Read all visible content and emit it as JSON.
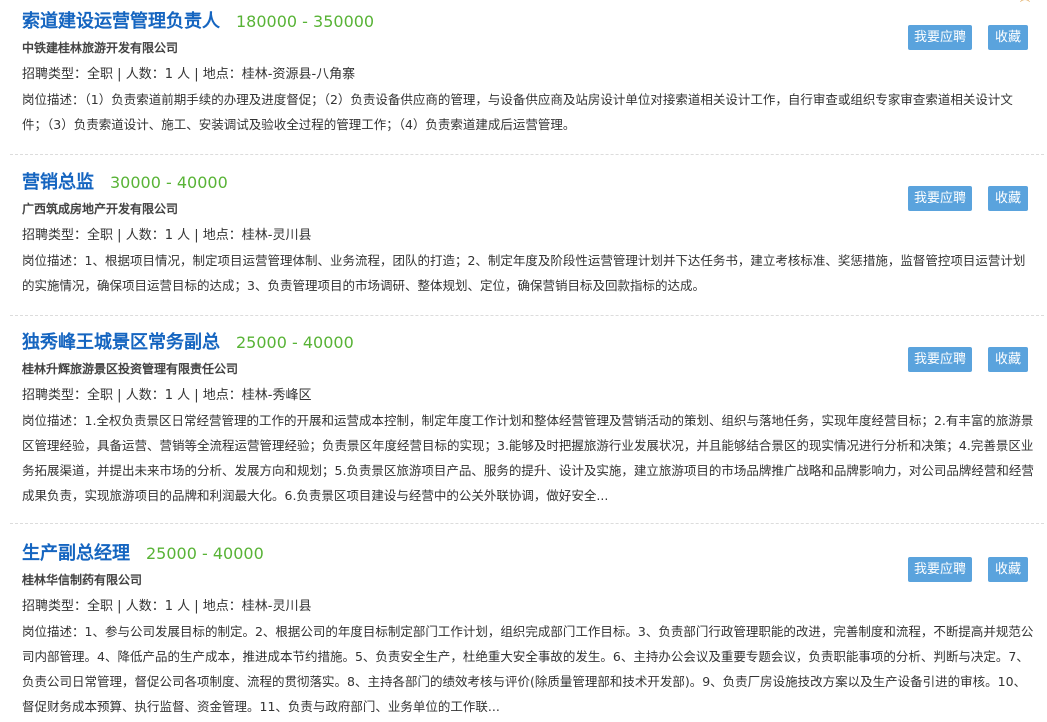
{
  "labels": {
    "type_prefix": "招聘类型：",
    "count_prefix": "人数：",
    "location_prefix": "地点：",
    "desc_prefix": "岗位描述：",
    "apply": "我要应聘",
    "save": "收藏"
  },
  "jobs": [
    {
      "title": "索道建设运营管理负责人",
      "salary": "180000 - 350000",
      "company": "中铁建桂林旅游开发有限公司",
      "type": "全职",
      "count": "1 人",
      "location": "桂林-资源县-八角寨",
      "description": "（1）负责索道前期手续的办理及进度督促；（2）负责设备供应商的管理，与设备供应商及站房设计单位对接索道相关设计工作，自行审查或组织专家审查索道相关设计文件；（3）负责索道设计、施工、安装调试及验收全过程的管理工作；（4）负责索道建成后运营管理。"
    },
    {
      "title": "营销总监",
      "salary": "30000 - 40000",
      "company": "广西筑成房地产开发有限公司",
      "type": "全职",
      "count": "1 人",
      "location": "桂林-灵川县",
      "description": "1、根据项目情况，制定项目运营管理体制、业务流程，团队的打造；2、制定年度及阶段性运营管理计划并下达任务书，建立考核标准、奖惩措施，监督管控项目运营计划的实施情况，确保项目运营目标的达成；3、负责管理项目的市场调研、整体规划、定位，确保营销目标及回款指标的达成。"
    },
    {
      "title": "独秀峰王城景区常务副总",
      "salary": "25000 - 40000",
      "company": "桂林升辉旅游景区投资管理有限责任公司",
      "type": "全职",
      "count": "1 人",
      "location": "桂林-秀峰区",
      "description": "1.全权负责景区日常经营管理的工作的开展和运营成本控制，制定年度工作计划和整体经营管理及营销活动的策划、组织与落地任务，实现年度经营目标；2.有丰富的旅游景区管理经验，具备运营、营销等全流程运营管理经验；负责景区年度经营目标的实现；3.能够及时把握旅游行业发展状况，并且能够结合景区的现实情况进行分析和决策；4.完善景区业务拓展渠道，并提出未来市场的分析、发展方向和规划；5.负责景区旅游项目产品、服务的提升、设计及实施，建立旅游项目的市场品牌推广战略和品牌影响力，对公司品牌经营和经营成果负责，实现旅游项目的品牌和利润最大化。6.负责景区项目建设与经营中的公关外联协调，做好安全..."
    },
    {
      "title": "生产副总经理",
      "salary": "25000 - 40000",
      "company": "桂林华信制药有限公司",
      "type": "全职",
      "count": "1 人",
      "location": "桂林-灵川县",
      "description": "1、参与公司发展目标的制定。2、根据公司的年度目标制定部门工作计划，组织完成部门工作目标。3、负责部门行政管理职能的改进，完善制度和流程，不断提高并规范公司内部管理。4、降低产品的生产成本，推进成本节约措施。5、负责安全生产，杜绝重大安全事故的发生。6、主持办公会议及重要专题会议，负责职能事项的分析、判断与决定。7、负责公司日常管理，督促公司各项制度、流程的贯彻落实。8、主持各部门的绩效考核与评价(除质量管理部和技术开发部)。9、负责厂房设施技改方案以及生产设备引进的审核。10、督促财务成本预算、执行监督、资金管理。11、负责与政府部门、业务单位的工作联..."
    }
  ]
}
